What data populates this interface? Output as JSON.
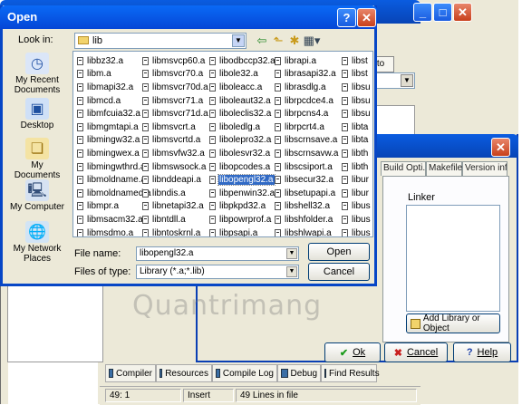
{
  "ide": {
    "tab_to": "to",
    "bottom_tabs": [
      {
        "label": "Compiler",
        "icon": "compiler-icon"
      },
      {
        "label": "Resources",
        "icon": "resources-icon"
      },
      {
        "label": "Compile Log",
        "icon": "compile-log-icon"
      },
      {
        "label": "Debug",
        "icon": "debug-icon"
      },
      {
        "label": "Find Results",
        "icon": "find-results-icon"
      }
    ],
    "status": {
      "position": "49: 1",
      "mode": "Insert",
      "lines": "49 Lines in file"
    },
    "title_buttons": [
      "_",
      "□",
      "✕"
    ]
  },
  "options_dialog": {
    "close": "✕",
    "tabs": [
      "Build Opti...",
      "Makefile",
      "Version info"
    ],
    "linker_label": "Linker",
    "add_library_button": "Add Library or Object",
    "ok_button": "Ok",
    "cancel_button": "Cancel",
    "help_button": "Help"
  },
  "open_dialog": {
    "title": "Open",
    "help_glyph": "?",
    "close_glyph": "✕",
    "look_in_label": "Look in:",
    "look_in_value": "lib",
    "places": [
      {
        "label": "My Recent Documents",
        "icon": "recent-documents-icon"
      },
      {
        "label": "Desktop",
        "icon": "desktop-icon"
      },
      {
        "label": "My Documents",
        "icon": "my-documents-icon"
      },
      {
        "label": "My Computer",
        "icon": "my-computer-icon"
      },
      {
        "label": "My Network Places",
        "icon": "network-places-icon"
      }
    ],
    "files": [
      [
        "libbz32.a",
        "libm.a",
        "libmapi32.a",
        "libmcd.a",
        "libmfcuia32.a",
        "libmgmtapi.a",
        "libmingw32.a",
        "libmingwex.a",
        "libmingwthrd.a",
        "libmoldname.a",
        "libmoldnamed.a",
        "libmpr.a",
        "libmsacm32.a",
        "libmsdmo.a",
        "libmsimg32.a"
      ],
      [
        "libmsvcp60.a",
        "libmsvcr70.a",
        "libmsvcr70d.a",
        "libmsvcr71.a",
        "libmsvcr71d.a",
        "libmsvcrt.a",
        "libmsvcrtd.a",
        "libmsvfw32.a",
        "libmswsock.a",
        "libnddeapi.a",
        "libndis.a",
        "libnetapi32.a",
        "libntdll.a",
        "libntoskrnl.a",
        "libodbc32.a"
      ],
      [
        "libodbccp32.a",
        "libole32.a",
        "liboleacc.a",
        "liboleaut32.a",
        "liboleclis32.a",
        "liboledlg.a",
        "libolepro32.a",
        "libolesvr32.a",
        "libopcodes.a",
        "libopengl32.a",
        "libpenwin32.a",
        "libpkpd32.a",
        "libpowrprof.a",
        "libpsapi.a",
        "libquartz.a"
      ],
      [
        "librapi.a",
        "librasapi32.a",
        "librasdlg.a",
        "librpcdce4.a",
        "librpcns4.a",
        "librpcrt4.a",
        "libscrnsave.a",
        "libscrnsavw.a",
        "libscsiport.a",
        "libsecur32.a",
        "libsetupapi.a",
        "libshell32.a",
        "libshfolder.a",
        "libshlwapi.a",
        "libsnmpapi.a"
      ],
      [
        "libst",
        "libst",
        "libsu",
        "libsu",
        "libsu",
        "libta",
        "libta",
        "libth",
        "libth",
        "libur",
        "libur",
        "libus",
        "libus",
        "libus",
        "libus"
      ]
    ],
    "selected_file": "libopengl32.a",
    "file_name_label": "File name:",
    "file_name_value": "libopengl32.a",
    "files_of_type_label": "Files of type:",
    "files_of_type_value": "Library (*.a;*.lib)",
    "open_button": "Open",
    "cancel_button": "Cancel"
  },
  "watermark": "Quantrimang"
}
